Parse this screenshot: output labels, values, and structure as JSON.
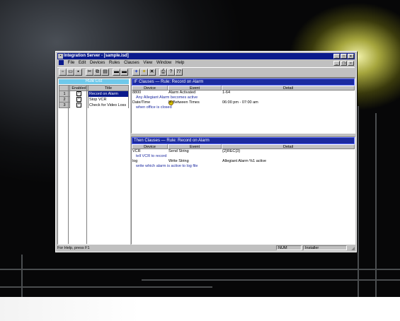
{
  "window": {
    "title": "Integration Server - [sample.isd]",
    "controls": [
      "_",
      "□",
      "×"
    ],
    "mdi_controls": [
      "_",
      "ѐ",
      "×"
    ]
  },
  "menu": [
    "File",
    "Edit",
    "Devices",
    "Rules",
    "Clauses",
    "View",
    "Window",
    "Help"
  ],
  "toolbar_icons": [
    "new-icon",
    "open-icon",
    "save-icon",
    "cut-icon",
    "copy-icon",
    "paste-icon",
    "device-icon",
    "rule-icon",
    "add-icon",
    "star-icon",
    "delete-icon",
    "print-icon",
    "help-icon",
    "context-help-icon"
  ],
  "rule_list": {
    "title": "Rule List",
    "headers": [
      "",
      "Enabled",
      "Title"
    ],
    "rows": [
      {
        "num": "1",
        "enabled": "×",
        "title": "Record on Alarm",
        "selected": true
      },
      {
        "num": "2",
        "enabled": "×",
        "title": "Stop VCR",
        "selected": false
      },
      {
        "num": "3",
        "enabled": "×",
        "title": "Check for Video Loss",
        "selected": false
      }
    ]
  },
  "if_clauses": {
    "title": "IF Clauses  —  Rule: Record on Alarm",
    "headers": [
      "Device",
      "Event",
      "Detail"
    ],
    "rows": [
      {
        "device": "8800",
        "event": "Alarm Activated",
        "detail": "1-64",
        "note": "Any Allegiant Alarm becomes active"
      },
      {
        "device": "Date/Time",
        "event": "In Between Times",
        "detail": "06:00 pm - 07:00 am",
        "note": "when office is closed"
      }
    ]
  },
  "then_clauses": {
    "title": "Then Clauses  —  Rule: Record on Alarm",
    "headers": [
      "Device",
      "Event",
      "Detail"
    ],
    "rows": [
      {
        "device": "VCR",
        "event": "Send String",
        "detail": "{2}REC{3}",
        "note": "tell VCR to record"
      },
      {
        "device": "log",
        "event": "Write String",
        "detail": "Allegiant Alarm %1 active",
        "note": "write which alarm is active to log file"
      }
    ]
  },
  "status": {
    "help": "For Help, press F1",
    "num": "NUM",
    "user": "Installer"
  },
  "colors": {
    "titlebar": "#0a1a8c",
    "pane_title": "#1c2ba0",
    "rule_list_title": "#6ec8ea",
    "note_text": "#1a28a0"
  }
}
